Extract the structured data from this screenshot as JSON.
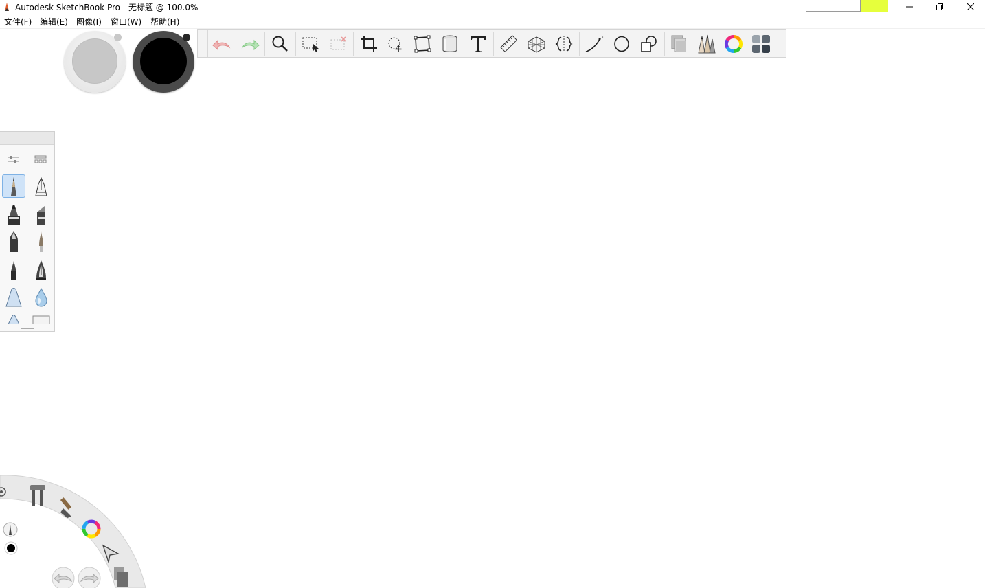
{
  "window": {
    "title": "Autodesk SketchBook Pro - 无标题 @ 100.0%",
    "app_icon": "pencil-app-icon",
    "controls": [
      "minimize-icon",
      "restore-icon",
      "close-icon"
    ],
    "highlight_color": "#e6ff3c"
  },
  "menu": {
    "items": [
      {
        "label": "文件(F)"
      },
      {
        "label": "编辑(E)"
      },
      {
        "label": "图像(I)"
      },
      {
        "label": "窗口(W)"
      },
      {
        "label": "帮助(H)"
      }
    ]
  },
  "color_swatches": [
    {
      "name": "secondary-color",
      "color": "#c7c7c7"
    },
    {
      "name": "primary-color",
      "color": "#000000"
    }
  ],
  "toolbar": {
    "tools": [
      "undo-icon",
      "redo-icon",
      "zoom-icon",
      "select-icon",
      "clear-selection-icon",
      "crop-icon",
      "transform-icon",
      "distort-icon",
      "fill-icon",
      "text-icon",
      "ruler-icon",
      "perspective-icon",
      "symmetry-icon",
      "curve-icon",
      "ellipse-icon",
      "shapes-icon",
      "layers-icon",
      "brushes-icon",
      "color-wheel-icon",
      "copic-library-icon"
    ]
  },
  "brush_palette": {
    "controls": [
      "brush-properties-icon",
      "brush-library-icon"
    ],
    "brushes": [
      "pencil-brush",
      "ballpoint-pen-brush",
      "marker-brush",
      "chisel-marker-brush",
      "felt-pen-brush",
      "paint-brush",
      "ink-pen-brush",
      "fountain-pen-brush",
      "airbrush-brush",
      "water-drop-brush",
      "airbrush-small-brush",
      "eraser-brush"
    ],
    "selected_index": 0
  },
  "lagoon": {
    "items": [
      "gear-icon",
      "tools-icon",
      "brush-icon",
      "color-wheel-icon",
      "select-arrow-icon",
      "layers-icon",
      "undo-icon",
      "redo-icon",
      "brush-preview-icon",
      "color-dot-icon"
    ]
  }
}
